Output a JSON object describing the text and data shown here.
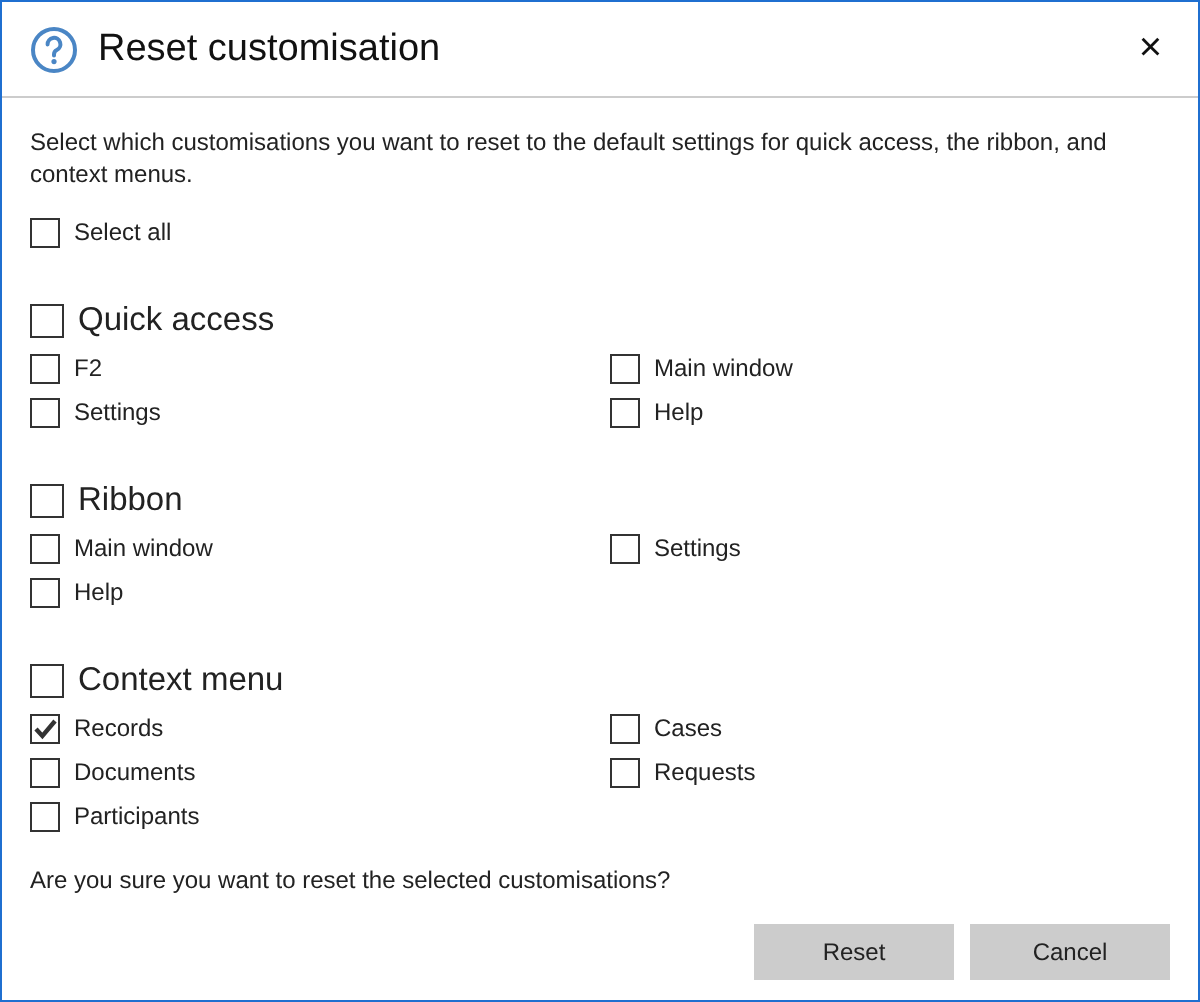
{
  "window": {
    "title": "Reset customisation",
    "close": "×"
  },
  "intro": "Select which customisations you want to reset to the default settings for quick access, the ribbon, and context menus.",
  "select_all": {
    "label": "Select all",
    "checked": false
  },
  "sections": [
    {
      "label": "Quick access",
      "checked": false,
      "items": [
        {
          "label": "F2",
          "checked": false
        },
        {
          "label": "Main window",
          "checked": false
        },
        {
          "label": "Settings",
          "checked": false
        },
        {
          "label": "Help",
          "checked": false
        }
      ]
    },
    {
      "label": "Ribbon",
      "checked": false,
      "items": [
        {
          "label": "Main window",
          "checked": false
        },
        {
          "label": "Settings",
          "checked": false
        },
        {
          "label": "Help",
          "checked": false
        }
      ]
    },
    {
      "label": "Context menu",
      "checked": false,
      "items": [
        {
          "label": "Records",
          "checked": true
        },
        {
          "label": "Cases",
          "checked": false
        },
        {
          "label": "Documents",
          "checked": false
        },
        {
          "label": "Requests",
          "checked": false
        },
        {
          "label": "Participants",
          "checked": false
        }
      ]
    }
  ],
  "question": "Are you sure you want to reset the selected customisations?",
  "buttons": [
    "Reset",
    "Cancel"
  ]
}
